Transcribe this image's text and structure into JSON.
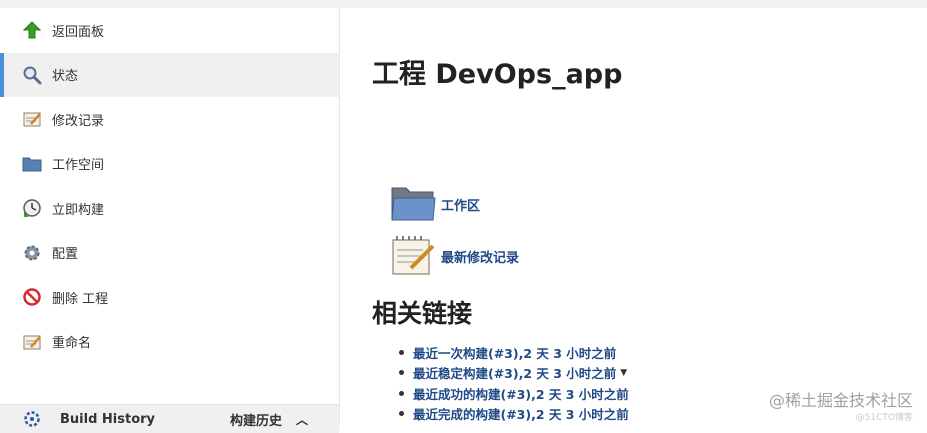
{
  "sidebar": {
    "items": [
      {
        "label": "返回面板",
        "icon": "up-arrow-icon"
      },
      {
        "label": "状态",
        "icon": "search-icon"
      },
      {
        "label": "修改记录",
        "icon": "notepad-icon"
      },
      {
        "label": "工作空间",
        "icon": "folder-icon"
      },
      {
        "label": "立即构建",
        "icon": "clock-build-icon"
      },
      {
        "label": "配置",
        "icon": "gear-icon"
      },
      {
        "label": "删除 工程",
        "icon": "no-entry-icon"
      },
      {
        "label": "重命名",
        "icon": "notepad-icon"
      }
    ],
    "active_index": 1,
    "build_history": {
      "title": "Build History",
      "label_cn": "构建历史",
      "caret": "︿"
    }
  },
  "main": {
    "title": "工程 DevOps_app",
    "workspace_link": "工作区",
    "changes_link": "最新修改记录",
    "related_title": "相关链接",
    "links": [
      "最近一次构建(#3),2 天 3 小时之前",
      "最近稳定构建(#3),2 天 3 小时之前",
      "最近成功的构建(#3),2 天 3 小时之前",
      "最近完成的构建(#3),2 天 3 小时之前"
    ]
  },
  "watermark": "@稀土掘金技术社区",
  "watermark_sub": "@51CTO博客",
  "colors": {
    "link": "#204a87",
    "active_bar": "#4a90d9",
    "active_bg": "#f0f0f0"
  }
}
